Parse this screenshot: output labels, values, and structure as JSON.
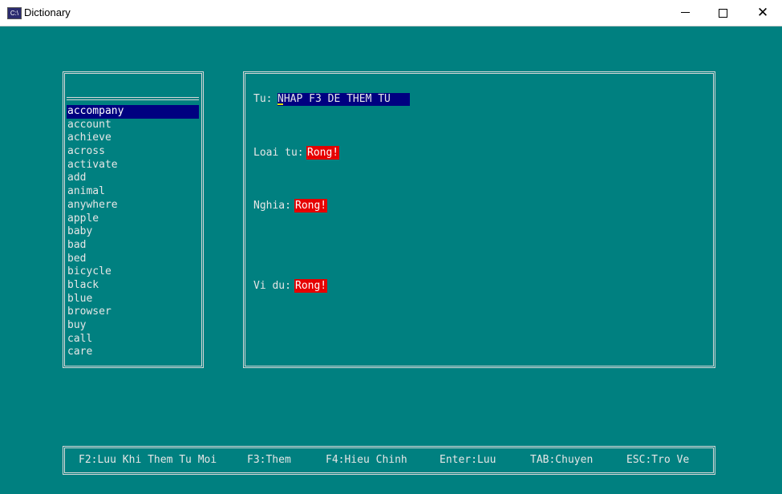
{
  "window": {
    "title": "Dictionary",
    "icon": "console-app-icon",
    "icon_text": "C:\\",
    "controls": [
      "minimize",
      "maximize",
      "close"
    ]
  },
  "word_list": {
    "search_value": "",
    "items": [
      "accompany",
      "account",
      "achieve",
      "across",
      "activate",
      "add",
      "animal",
      "anywhere",
      "apple",
      "baby",
      "bad",
      "bed",
      "bicycle",
      "black",
      "blue",
      "browser",
      "buy",
      "call",
      "care"
    ],
    "selected_index": 0
  },
  "detail": {
    "word_label": "Tu:",
    "word_value": "NHAP F3 DE THEM TU",
    "type_label": "Loai tu:",
    "type_value": "Rong!",
    "meaning_label": "Nghia:",
    "meaning_value": "Rong!",
    "example_label": "Vi du:",
    "example_value": "Rong!"
  },
  "footer": {
    "f2": "F2:Luu Khi Them Tu Moi",
    "f3": "F3:Them",
    "f4": "F4:Hieu Chinh",
    "enter": "Enter:Luu",
    "tab": "TAB:Chuyen",
    "esc": "ESC:Tro Ve"
  },
  "colors": {
    "background": "#008080",
    "highlight": "#000080",
    "error": "#e60000",
    "text": "#e6e6e6"
  }
}
